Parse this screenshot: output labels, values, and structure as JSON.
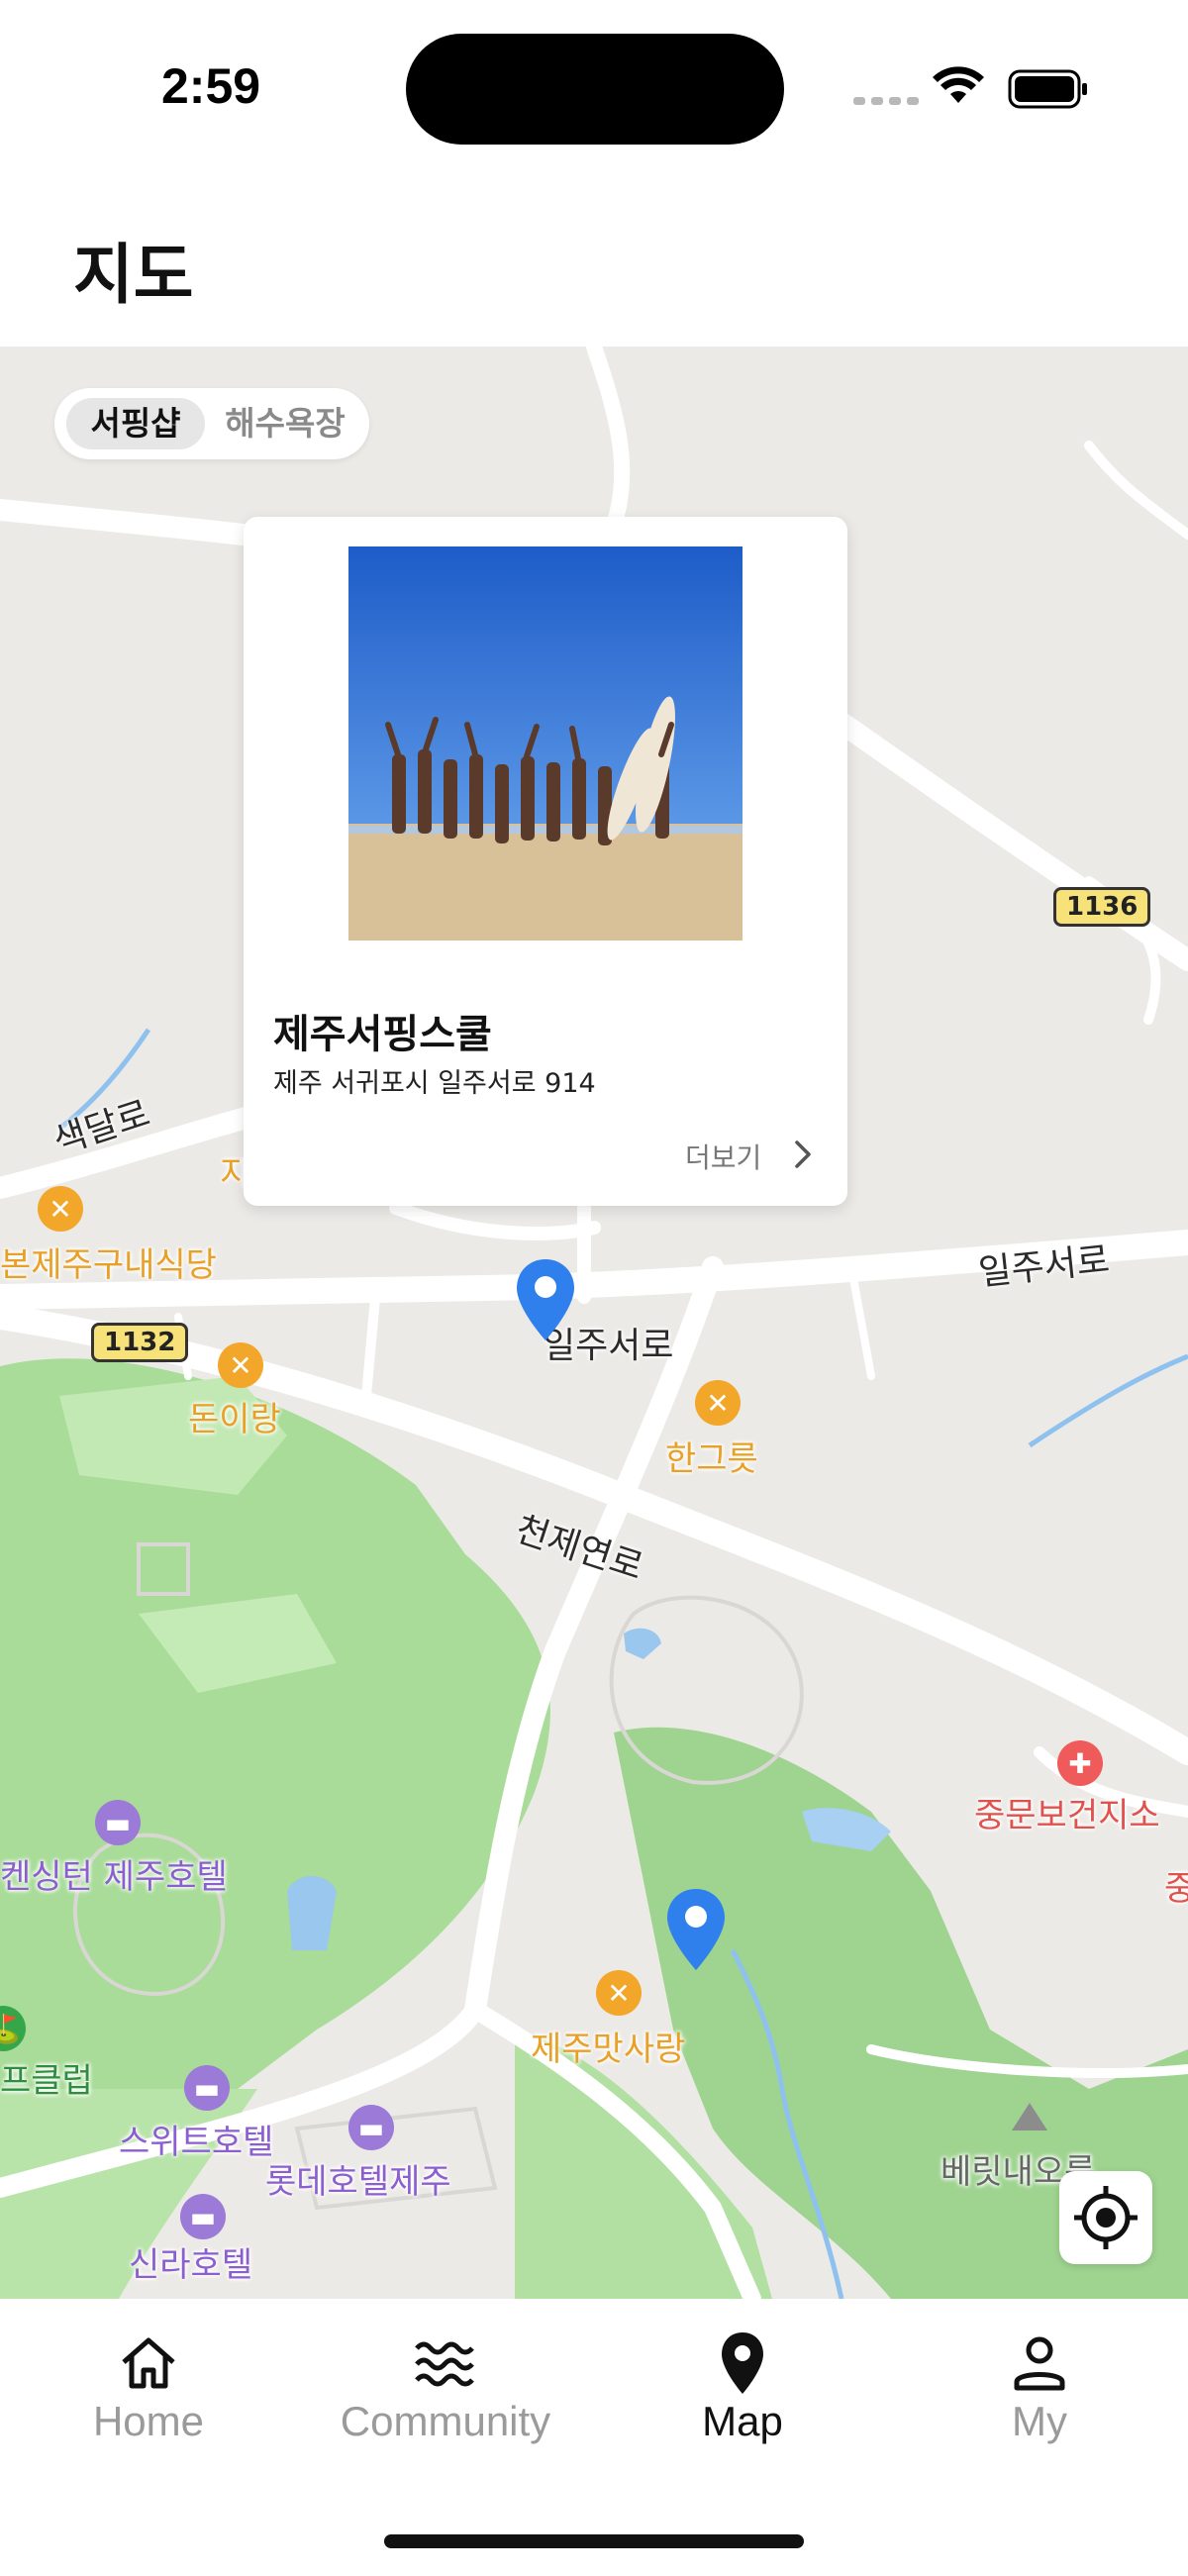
{
  "status_bar": {
    "time": "2:59"
  },
  "header": {
    "title": "지도"
  },
  "segment": {
    "options": [
      "서핑샵",
      "해수욕장"
    ],
    "selected": "서핑샵"
  },
  "card": {
    "name": "제주서핑스쿨",
    "address": "제주 서귀포시 일주서로 914",
    "more_label": "더보기"
  },
  "map_labels": {
    "road_saedal": "색달로",
    "road_iljuseo_1": "일주서로",
    "road_iljuseo_2": "일주서로",
    "road_cheonje": "천제연로",
    "restaurant_1": "본제주구내식당",
    "restaurant_partial": "지",
    "restaurant_2": "돈이랑",
    "restaurant_3": "한그릇",
    "restaurant_4": "제주맛사랑",
    "hotel_1": "켄싱턴 제주호텔",
    "hotel_2": "스위트호텔",
    "hotel_3": "롯데호텔제주",
    "hotel_4": "신라호텔",
    "golf": "프클럽",
    "health": "중문보건지소",
    "health_partial": "중",
    "mountain": "베릿내오름",
    "route_1136": "1136",
    "route_1132": "1132"
  },
  "tabbar": {
    "tabs": [
      {
        "label": "Home",
        "icon": "home-icon",
        "active": false
      },
      {
        "label": "Community",
        "icon": "waves-icon",
        "active": false
      },
      {
        "label": "Map",
        "icon": "map-pin-icon",
        "active": true
      },
      {
        "label": "My",
        "icon": "person-icon",
        "active": false
      }
    ]
  },
  "colors": {
    "pin_blue": "#2f80ed",
    "map_bg": "#eceae6",
    "park_green": "#a8dc98",
    "poi_orange": "#f3a72a",
    "poi_purple": "#9b7ad8"
  }
}
